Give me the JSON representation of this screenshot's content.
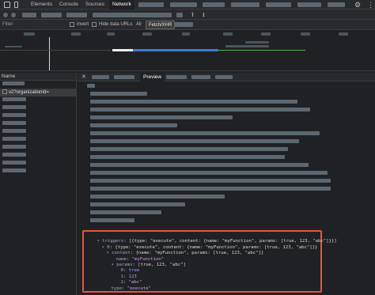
{
  "tabs": {
    "elements": "Elements",
    "console": "Console",
    "sources": "Sources",
    "network": "Network"
  },
  "icons": {
    "inspect": "inspect-icon",
    "device": "device-toolbar-icon",
    "settings": "gear-icon",
    "more": "more-vert-icon",
    "upload": "upload-icon",
    "download": "download-icon",
    "close": "close-icon"
  },
  "filter": {
    "placeholder": "Filter",
    "invert_label": "Invert",
    "hide_data_urls_label": "Hide data URLs",
    "all_label": "All",
    "fetch_xhr_label": "Fetch/XHR"
  },
  "requests": {
    "column_name": "Name",
    "selected_item": "v2?organizationId="
  },
  "details": {
    "preview_tab": "Preview"
  },
  "json_preview": {
    "line1_key": "triggers",
    "line1_value": "[{type: \"execute\", content: {name: \"myFunction\", params: [true, 123, \"abc\"]}}]",
    "line2_key": "0",
    "line2_value": "{type: \"execute\", content: {name: \"myFunction\", params: [true, 123, \"abc\"]}}",
    "line3_key": "content",
    "line3_value": "{name: \"myFunction\", params: [true, 123, \"abc\"]}",
    "line4_key": "name",
    "line4_value": "\"myFunction\"",
    "line5_key": "params",
    "line5_value": "[true, 123, \"abc\"]",
    "line6_key": "0",
    "line6_value": "true",
    "line7_key": "1",
    "line7_value": "123",
    "line8_key": "2",
    "line8_value": "\"abc\"",
    "line9_key": "type",
    "line9_value": "\"execute\""
  },
  "colors": {
    "highlight_border": "#e8543c",
    "background": "#202124",
    "redaction": "#5d6770"
  }
}
